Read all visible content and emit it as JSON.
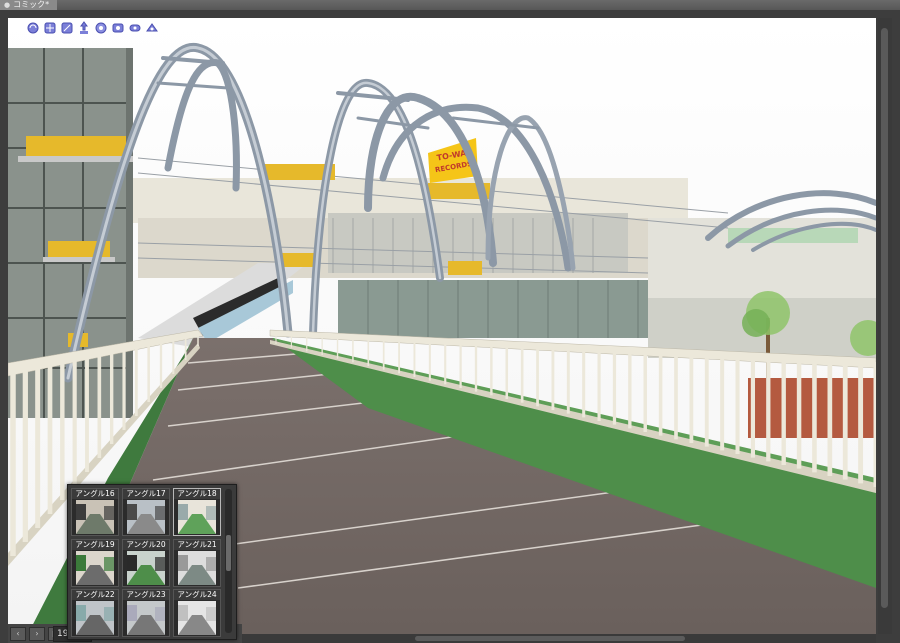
{
  "window": {
    "tab_title": "コミック*",
    "close_icon": "close-icon"
  },
  "toolbar": {
    "icons": [
      "camera-rotate-icon",
      "camera-pan-icon",
      "camera-zoom-icon",
      "object-move-icon",
      "object-rotate-icon",
      "light-icon",
      "fit-icon",
      "perspective-icon"
    ]
  },
  "scene": {
    "store_sign": {
      "line1": "TO-WA",
      "line2": "RECORDS",
      "color": "#f5c518"
    }
  },
  "statusbar": {
    "zoom": "19.0"
  },
  "angle_palette": {
    "items": [
      {
        "label": "アングル16"
      },
      {
        "label": "アングル17"
      },
      {
        "label": "アングル18"
      },
      {
        "label": "アングル19"
      },
      {
        "label": "アングル20"
      },
      {
        "label": "アングル21"
      },
      {
        "label": "アングル22"
      },
      {
        "label": "アングル23"
      },
      {
        "label": "アングル24"
      }
    ],
    "selected_index": 2
  },
  "colors": {
    "path": "#6f6561",
    "grass": "#4e8e4a",
    "railing": "#ece8da",
    "arch": "#8c98a6"
  }
}
